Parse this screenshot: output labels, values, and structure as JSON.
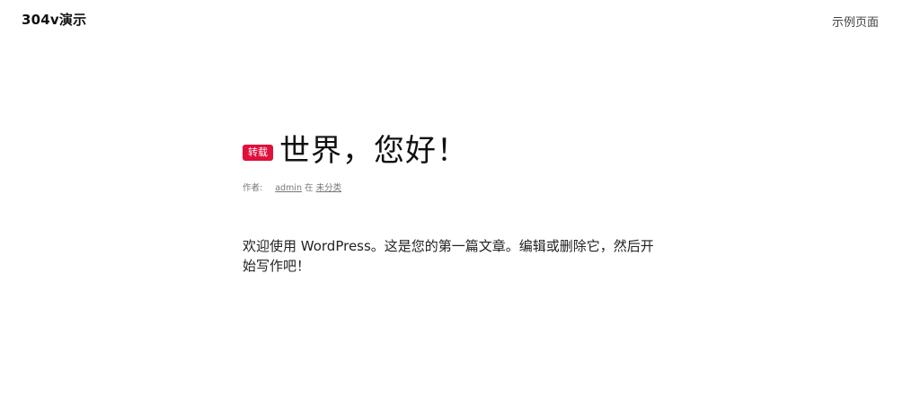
{
  "header": {
    "site_title": "304v演示",
    "nav": [
      {
        "label": "示例页面"
      }
    ]
  },
  "post": {
    "badge": "转载",
    "title": "世界，您好！",
    "meta": {
      "author_prefix": "作者:",
      "author": "admin",
      "in_text": "在",
      "category": "未分类"
    },
    "body": "欢迎使用 WordPress。这是您的第一篇文章。编辑或删除它，然后开始写作吧！"
  },
  "colors": {
    "badge_bg": "#e0103c",
    "text": "#111111",
    "meta": "#777777"
  }
}
